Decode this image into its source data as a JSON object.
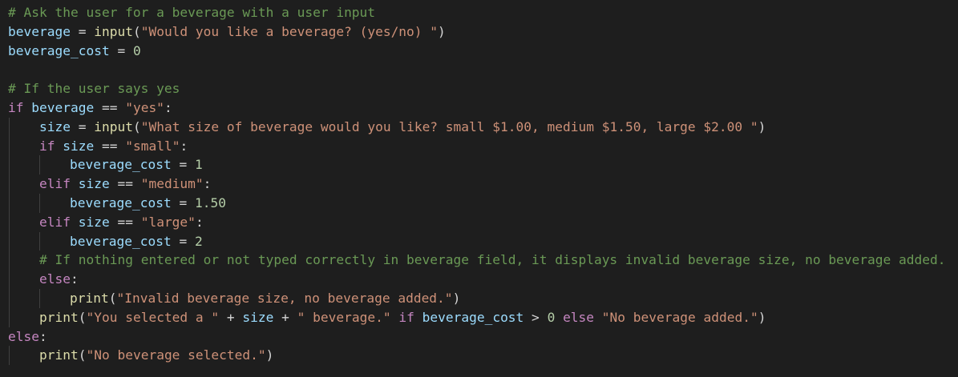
{
  "editor": {
    "lines": [
      {
        "indent": 0,
        "tokens": [
          {
            "t": "# Ask the user for a beverage with a user input",
            "c": "c"
          }
        ]
      },
      {
        "indent": 0,
        "tokens": [
          {
            "t": "beverage",
            "c": "v"
          },
          {
            "t": " = ",
            "c": "o"
          },
          {
            "t": "input",
            "c": "f"
          },
          {
            "t": "(",
            "c": "o"
          },
          {
            "t": "\"Would you like a beverage? (yes/no) \"",
            "c": "s"
          },
          {
            "t": ")",
            "c": "o"
          }
        ]
      },
      {
        "indent": 0,
        "tokens": [
          {
            "t": "beverage_cost",
            "c": "v"
          },
          {
            "t": " = ",
            "c": "o"
          },
          {
            "t": "0",
            "c": "n"
          }
        ]
      },
      {
        "indent": 0,
        "tokens": []
      },
      {
        "indent": 0,
        "tokens": [
          {
            "t": "# If the user says yes",
            "c": "c"
          }
        ]
      },
      {
        "indent": 0,
        "tokens": [
          {
            "t": "if",
            "c": "k"
          },
          {
            "t": " ",
            "c": "o"
          },
          {
            "t": "beverage",
            "c": "v"
          },
          {
            "t": " == ",
            "c": "o"
          },
          {
            "t": "\"yes\"",
            "c": "s"
          },
          {
            "t": ":",
            "c": "o"
          }
        ]
      },
      {
        "indent": 1,
        "tokens": [
          {
            "t": "size",
            "c": "v"
          },
          {
            "t": " = ",
            "c": "o"
          },
          {
            "t": "input",
            "c": "f"
          },
          {
            "t": "(",
            "c": "o"
          },
          {
            "t": "\"What size of beverage would you like? small $1.00, medium $1.50, large $2.00 \"",
            "c": "s"
          },
          {
            "t": ")",
            "c": "o"
          }
        ]
      },
      {
        "indent": 1,
        "tokens": [
          {
            "t": "if",
            "c": "k"
          },
          {
            "t": " ",
            "c": "o"
          },
          {
            "t": "size",
            "c": "v"
          },
          {
            "t": " == ",
            "c": "o"
          },
          {
            "t": "\"small\"",
            "c": "s"
          },
          {
            "t": ":",
            "c": "o"
          }
        ]
      },
      {
        "indent": 2,
        "tokens": [
          {
            "t": "beverage_cost",
            "c": "v"
          },
          {
            "t": " = ",
            "c": "o"
          },
          {
            "t": "1",
            "c": "n"
          }
        ]
      },
      {
        "indent": 1,
        "tokens": [
          {
            "t": "elif",
            "c": "k"
          },
          {
            "t": " ",
            "c": "o"
          },
          {
            "t": "size",
            "c": "v"
          },
          {
            "t": " == ",
            "c": "o"
          },
          {
            "t": "\"medium\"",
            "c": "s"
          },
          {
            "t": ":",
            "c": "o"
          }
        ]
      },
      {
        "indent": 2,
        "tokens": [
          {
            "t": "beverage_cost",
            "c": "v"
          },
          {
            "t": " = ",
            "c": "o"
          },
          {
            "t": "1.50",
            "c": "n"
          }
        ]
      },
      {
        "indent": 1,
        "tokens": [
          {
            "t": "elif",
            "c": "k"
          },
          {
            "t": " ",
            "c": "o"
          },
          {
            "t": "size",
            "c": "v"
          },
          {
            "t": " == ",
            "c": "o"
          },
          {
            "t": "\"large\"",
            "c": "s"
          },
          {
            "t": ":",
            "c": "o"
          }
        ]
      },
      {
        "indent": 2,
        "tokens": [
          {
            "t": "beverage_cost",
            "c": "v"
          },
          {
            "t": " = ",
            "c": "o"
          },
          {
            "t": "2",
            "c": "n"
          }
        ]
      },
      {
        "indent": 1,
        "tokens": [
          {
            "t": "# If nothing entered or not typed correctly in beverage field, it displays invalid beverage size, no beverage added.",
            "c": "c"
          }
        ]
      },
      {
        "indent": 1,
        "tokens": [
          {
            "t": "else",
            "c": "k"
          },
          {
            "t": ":",
            "c": "o"
          }
        ]
      },
      {
        "indent": 2,
        "tokens": [
          {
            "t": "print",
            "c": "f"
          },
          {
            "t": "(",
            "c": "o"
          },
          {
            "t": "\"Invalid beverage size, no beverage added.\"",
            "c": "s"
          },
          {
            "t": ")",
            "c": "o"
          }
        ]
      },
      {
        "indent": 1,
        "tokens": [
          {
            "t": "print",
            "c": "f"
          },
          {
            "t": "(",
            "c": "o"
          },
          {
            "t": "\"You selected a \"",
            "c": "s"
          },
          {
            "t": " + ",
            "c": "o"
          },
          {
            "t": "size",
            "c": "v"
          },
          {
            "t": " + ",
            "c": "o"
          },
          {
            "t": "\" beverage.\"",
            "c": "s"
          },
          {
            "t": " ",
            "c": "o"
          },
          {
            "t": "if",
            "c": "k"
          },
          {
            "t": " ",
            "c": "o"
          },
          {
            "t": "beverage_cost",
            "c": "v"
          },
          {
            "t": " > ",
            "c": "o"
          },
          {
            "t": "0",
            "c": "n"
          },
          {
            "t": " ",
            "c": "o"
          },
          {
            "t": "else",
            "c": "k"
          },
          {
            "t": " ",
            "c": "o"
          },
          {
            "t": "\"No beverage added.\"",
            "c": "s"
          },
          {
            "t": ")",
            "c": "o"
          }
        ]
      },
      {
        "indent": 0,
        "tokens": [
          {
            "t": "else",
            "c": "k"
          },
          {
            "t": ":",
            "c": "o"
          }
        ]
      },
      {
        "indent": 1,
        "tokens": [
          {
            "t": "print",
            "c": "f"
          },
          {
            "t": "(",
            "c": "o"
          },
          {
            "t": "\"No beverage selected.\"",
            "c": "s"
          },
          {
            "t": ")",
            "c": "o"
          }
        ]
      }
    ],
    "colors": {
      "background": "#1e1e1e",
      "comment": "#6a9955",
      "variable": "#9cdcfe",
      "keyword": "#c586c0",
      "function": "#dcdcaa",
      "string": "#ce9178",
      "number": "#b5cea8",
      "plain": "#d4d4d4"
    }
  }
}
